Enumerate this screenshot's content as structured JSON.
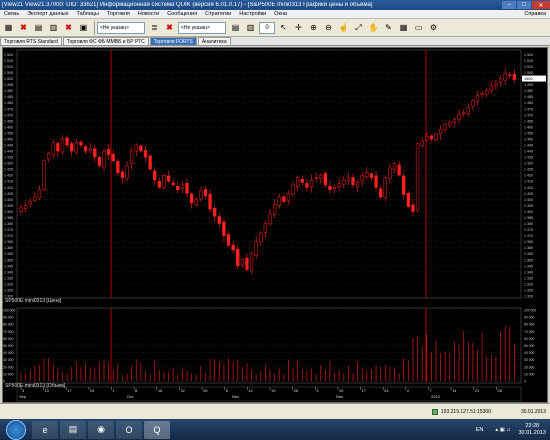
{
  "window": {
    "title": "[View21 View21.37000: UID: 33621] Информационная система QUIK (версия 6.01.0.17) - [S&P500E mini0313 Графики цены и объема]",
    "min": "–",
    "max": "□",
    "close": "✕"
  },
  "menu": [
    "Связь",
    "Экспорт данных",
    "Таблицы",
    "Торговля",
    "Новости",
    "Сообщения",
    "Стратегии",
    "Настройки",
    "Окна"
  ],
  "menu_right": "Справка",
  "toolbar": {
    "select1": "<Не указан>",
    "select2": "<Не указан>",
    "number": "0"
  },
  "tabs": [
    {
      "label": "Торговля RTS Standard",
      "active": false
    },
    {
      "label": "Торговля ФС ФБ ММВБ и БР РТС",
      "active": false
    },
    {
      "label": "Торговля FORTS",
      "active": true
    },
    {
      "label": "Аналитика",
      "active": false
    }
  ],
  "price_panel": {
    "label": "SP500E mini0313 [Цена]",
    "yticks": [
      1520,
      1515,
      1510,
      1505,
      1500,
      1495,
      1490,
      1485,
      1480,
      1475,
      1470,
      1465,
      1460,
      1455,
      1450,
      1445,
      1440,
      1435,
      1430,
      1425,
      1420,
      1415,
      1410,
      1405,
      1400,
      1395,
      1390,
      1385,
      1380,
      1375,
      1370,
      1365,
      1360,
      1355,
      1350,
      1345,
      1340,
      1335,
      1330,
      1325,
      1320
    ],
    "ylim": [
      1320,
      1522
    ],
    "last_price": "1500"
  },
  "volume_panel": {
    "label": "SP500E mini0313 [Объем]",
    "yticks": [
      "100 000",
      "90 000",
      "80 000",
      "70 000",
      "60 000",
      "50 000",
      "40 000",
      "30 000",
      "20 000",
      "10 000",
      "0"
    ]
  },
  "xaxis": {
    "day_ticks": [
      "3",
      "10",
      "17",
      "24",
      "1",
      "8",
      "15",
      "22",
      "29",
      "5",
      "12",
      "19",
      "26",
      "3",
      "10",
      "17",
      "24",
      "2",
      "7",
      "14",
      "21",
      "28"
    ],
    "months": [
      "Sep",
      "Oct",
      "Nov",
      "Dec",
      "2013"
    ]
  },
  "chart_data": {
    "type": "candlestick",
    "note_series": "Price (candles) and volume (bars)",
    "closes": [
      1393,
      1395,
      1398,
      1402,
      1408,
      1432,
      1438,
      1447,
      1440,
      1450,
      1445,
      1440,
      1447,
      1445,
      1440,
      1442,
      1435,
      1428,
      1440,
      1437,
      1432,
      1422,
      1418,
      1428,
      1440,
      1445,
      1440,
      1435,
      1425,
      1416,
      1410,
      1420,
      1415,
      1412,
      1408,
      1412,
      1405,
      1397,
      1400,
      1407,
      1403,
      1392,
      1386,
      1380,
      1370,
      1362,
      1358,
      1345,
      1350,
      1342,
      1355,
      1365,
      1372,
      1380,
      1388,
      1396,
      1402,
      1398,
      1405,
      1412,
      1418,
      1414,
      1410,
      1416,
      1418,
      1420,
      1412,
      1408,
      1410,
      1413,
      1416,
      1418,
      1412,
      1414,
      1420,
      1422,
      1418,
      1410,
      1402,
      1418,
      1426,
      1430,
      1420,
      1404,
      1394,
      1390,
      1446,
      1448,
      1452,
      1450,
      1454,
      1458,
      1462,
      1464,
      1466,
      1470,
      1472,
      1476,
      1482,
      1486,
      1488,
      1490,
      1494,
      1496,
      1500,
      1504,
      1503,
      1499
    ]
  },
  "status": {
    "connection": "193.219.127.51:15300",
    "date": "30.01.2013"
  },
  "taskbar": {
    "lang": "EN",
    "time": "23:28",
    "date": "30.01.2013"
  }
}
